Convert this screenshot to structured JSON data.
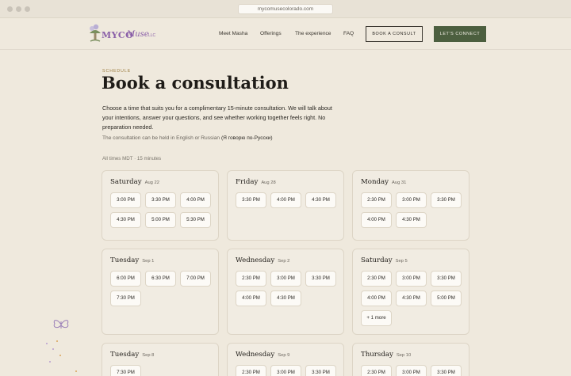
{
  "browser": {
    "url": "mycomusecolorado.com"
  },
  "header": {
    "logo_word": "MYCO",
    "logo_script": "Muse",
    "logo_suffix": "LLC",
    "nav": [
      "Meet Masha",
      "Offerings",
      "The experience",
      "FAQ"
    ],
    "book_button": "BOOK A CONSULT",
    "connect_button": "LET'S CONNECT"
  },
  "intro": {
    "eyebrow": "SCHEDULE",
    "title": "Book a consultation",
    "description": "Choose a time that suits you for a complimentary 15-minute consultation. We will talk about your intentions, answer your questions, and see whether working together feels right. No preparation needed.",
    "language_note": "The consultation can be held in English or Russian",
    "language_note_ru": "(Я говорю по-Русски)",
    "timezone": "All times MDT · 15 minutes"
  },
  "days": [
    {
      "day": "Saturday",
      "date": "Aug 22",
      "slots": [
        "3:00 PM",
        "3:30 PM",
        "4:00 PM",
        "4:30 PM",
        "5:00 PM",
        "5:30 PM"
      ]
    },
    {
      "day": "Friday",
      "date": "Aug 28",
      "slots": [
        "3:30 PM",
        "4:00 PM",
        "4:30 PM"
      ]
    },
    {
      "day": "Monday",
      "date": "Aug 31",
      "slots": [
        "2:30 PM",
        "3:00 PM",
        "3:30 PM",
        "4:00 PM",
        "4:30 PM"
      ]
    },
    {
      "day": "Tuesday",
      "date": "Sep 1",
      "slots": [
        "6:00 PM",
        "6:30 PM",
        "7:00 PM",
        "7:30 PM"
      ]
    },
    {
      "day": "Wednesday",
      "date": "Sep 2",
      "slots": [
        "2:30 PM",
        "3:00 PM",
        "3:30 PM",
        "4:00 PM",
        "4:30 PM"
      ]
    },
    {
      "day": "Saturday",
      "date": "Sep 5",
      "slots": [
        "2:30 PM",
        "3:00 PM",
        "3:30 PM",
        "4:00 PM",
        "4:30 PM",
        "5:00 PM"
      ],
      "more": "+ 1 more"
    },
    {
      "day": "Tuesday",
      "date": "Sep 8",
      "slots": [
        "7:30 PM"
      ]
    },
    {
      "day": "Wednesday",
      "date": "Sep 9",
      "slots": [
        "2:30 PM",
        "3:00 PM",
        "3:30 PM"
      ]
    },
    {
      "day": "Thursday",
      "date": "Sep 10",
      "slots": [
        "2:30 PM",
        "3:00 PM",
        "3:30 PM"
      ]
    }
  ],
  "colors": {
    "background": "#efe9dd",
    "accent_green": "#4c5f3f",
    "logo_purple": "#8a5fa8",
    "eyebrow_gold": "#9a7a3c"
  }
}
